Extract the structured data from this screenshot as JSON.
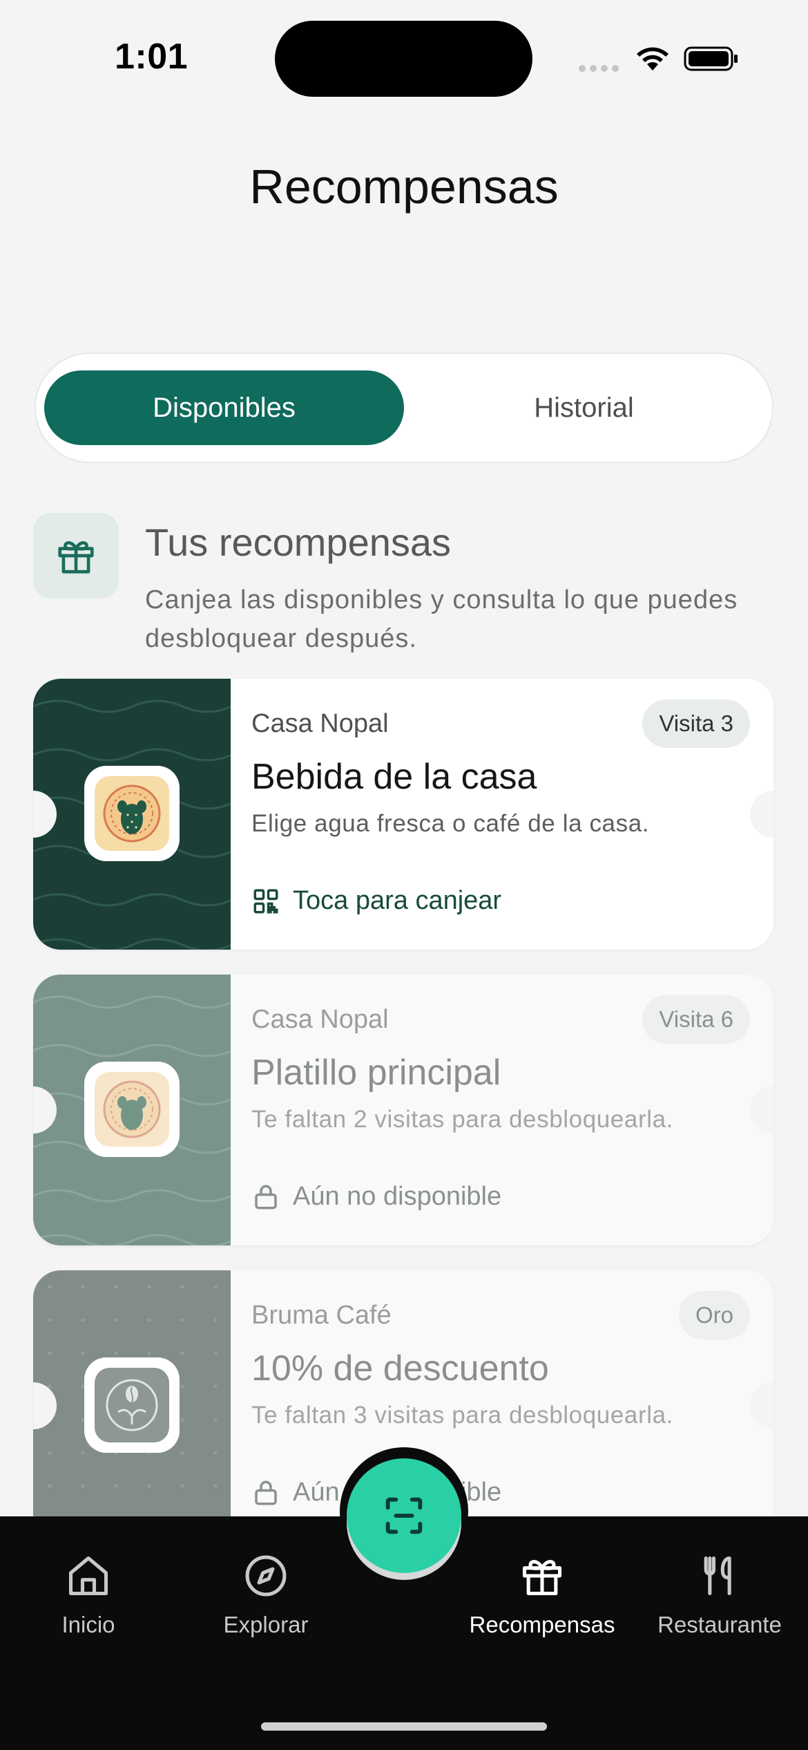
{
  "status_bar": {
    "time": "1:01"
  },
  "header": {
    "title": "Recompensas"
  },
  "tabs": [
    {
      "label": "Disponibles",
      "active": true
    },
    {
      "label": "Historial",
      "active": false
    }
  ],
  "section": {
    "icon": "gift-icon",
    "title": "Tus recompensas",
    "subtitle": "Canjea las disponibles y consulta lo que puedes desbloquear después."
  },
  "rewards": [
    {
      "restaurant": "Casa Nopal",
      "badge": "Visita 3",
      "title": "Bebida de la casa",
      "description": "Elige agua fresca o café de la casa.",
      "action": "Toca para canjear",
      "action_icon": "qr-code-icon",
      "status": "available",
      "accent": "#1b3f37"
    },
    {
      "restaurant": "Casa Nopal",
      "badge": "Visita 6",
      "title": "Platillo principal",
      "description": "Te faltan 2 visitas para desbloquearla.",
      "action": "Aún no disponible",
      "action_icon": "lock-icon",
      "status": "locked",
      "accent": "#7a948c"
    },
    {
      "restaurant": "Bruma Café",
      "badge": "Oro",
      "title": "10% de descuento",
      "description": "Te faltan 3 visitas para desbloquearla.",
      "action": "Aún no disponible",
      "action_icon": "lock-icon",
      "status": "locked",
      "accent": "#828c88"
    }
  ],
  "scan_button": {
    "icon": "scan-icon",
    "color": "#2bcfa5"
  },
  "nav": [
    {
      "label": "Inicio",
      "icon": "home-icon",
      "active": false
    },
    {
      "label": "Explorar",
      "icon": "compass-icon",
      "active": false
    },
    {
      "label": "Recompensas",
      "icon": "gift-icon",
      "active": true
    },
    {
      "label": "Restaurante",
      "icon": "fork-knife-icon",
      "active": false
    }
  ]
}
